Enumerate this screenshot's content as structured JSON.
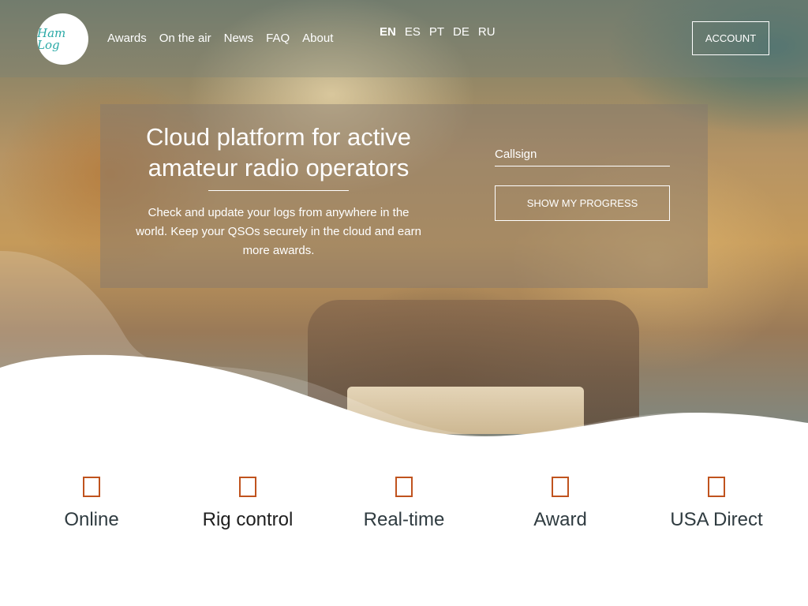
{
  "brand": {
    "logo_text": "Ham Log"
  },
  "nav": {
    "links": [
      "Awards",
      "On the air",
      "News",
      "FAQ",
      "About"
    ],
    "languages": [
      "EN",
      "ES",
      "PT",
      "DE",
      "RU"
    ],
    "active_language": "EN",
    "account_label": "ACCOUNT"
  },
  "hero": {
    "title": "Cloud platform for active amateur radio operators",
    "description": "Check and update your logs from anywhere in the world. Keep your QSOs securely in the cloud and earn more awards.",
    "callsign_placeholder": "Callsign",
    "button_label": "SHOW MY PROGRESS"
  },
  "features": [
    {
      "title": "Online",
      "icon": "cloud-icon"
    },
    {
      "title": "Rig control",
      "icon": "rig-icon"
    },
    {
      "title": "Real-time",
      "icon": "clock-icon"
    },
    {
      "title": "Award",
      "icon": "award-icon"
    },
    {
      "title": "USA Direct",
      "icon": "usa-icon"
    }
  ],
  "colors": {
    "accent": "#c0531e",
    "feature_text": "#2f3b40"
  }
}
